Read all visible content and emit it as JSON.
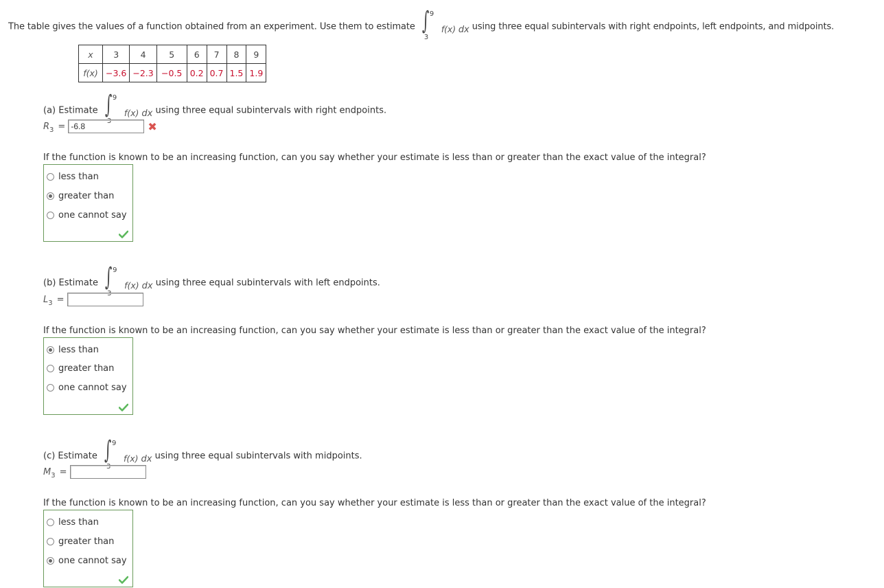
{
  "intro": {
    "before": "The table gives the values of a function obtained from an experiment. Use them to estimate",
    "integral": {
      "lower": "3",
      "upper": "9",
      "integrand": "f(x)",
      "dx": "dx"
    },
    "after": "using three equal subintervals with right endpoints, left endpoints, and midpoints."
  },
  "table": {
    "x_label": "x",
    "fx_label": "f(x)",
    "x": [
      "3",
      "4",
      "5",
      "6",
      "7",
      "8",
      "9"
    ],
    "fx": [
      "−3.6",
      "−2.3",
      "−0.5",
      "0.2",
      "0.7",
      "1.5",
      "1.9"
    ]
  },
  "parts": [
    {
      "label": "(a) Estimate",
      "method_text": "using three equal subintervals with right endpoints.",
      "var": "R",
      "sub": "3",
      "eq": "=",
      "answer": "-6.8",
      "answer_status": "incorrect",
      "prompt": "If the function is known to be an increasing function, can you say whether your estimate is less than or greater than the exact value of the integral?",
      "options": [
        "less than",
        "greater than",
        "one cannot say"
      ],
      "selected": "greater than",
      "choice_status": "correct"
    },
    {
      "label": "(b) Estimate",
      "method_text": "using three equal subintervals with left endpoints.",
      "var": "L",
      "sub": "3",
      "eq": "=",
      "answer": "",
      "prompt": "If the function is known to be an increasing function, can you say whether your estimate is less than or greater than the exact value of the integral?",
      "options": [
        "less than",
        "greater than",
        "one cannot say"
      ],
      "selected": "less than",
      "choice_status": "correct"
    },
    {
      "label": "(c) Estimate",
      "method_text": "using three equal subintervals with midpoints.",
      "var": "M",
      "sub": "3",
      "eq": "=",
      "answer": "",
      "prompt": "If the function is known to be an increasing function, can you say whether your estimate is less than or greater than the exact value of the integral?",
      "options": [
        "less than",
        "greater than",
        "one cannot say"
      ],
      "selected": "one cannot say",
      "choice_status": "correct"
    }
  ],
  "colors": {
    "negative_value": "#c8102e",
    "correct": "#5cb85c",
    "incorrect": "#d9534f",
    "box_border": "#6a9a5a"
  }
}
